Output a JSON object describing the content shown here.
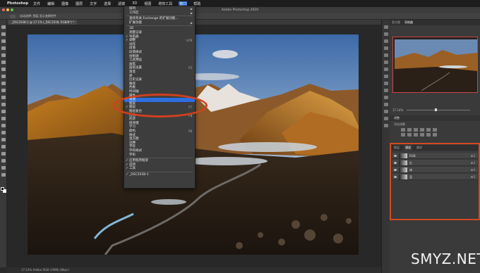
{
  "menubar": {
    "app": "Photoshop",
    "items": [
      "文件",
      "编辑",
      "图像",
      "图层",
      "文字",
      "选择",
      "滤镜",
      "3D",
      "视图",
      "增效工具",
      "窗口",
      "帮助"
    ],
    "active_index": 10
  },
  "window": {
    "title": "Adobe Photoshop 2020"
  },
  "document": {
    "tab": "_DSC2038-1 @ 17.1% (_DSC2038, RGB/8*) *"
  },
  "statusbar": {
    "text": "17.14%    Adobe RGB (1998) (8bpc)"
  },
  "window_menu": {
    "items": [
      {
        "label": "排列",
        "arrow": true
      },
      {
        "label": "工作区",
        "arrow": true
      },
      {
        "sep": true
      },
      {
        "label": "查找有关 Exchange 的扩展功能..."
      },
      {
        "label": "扩展功能",
        "arrow": true
      },
      {
        "sep": true
      },
      {
        "label": "3D"
      },
      {
        "label": "测量记录"
      },
      {
        "label": "导航器",
        "check": true
      },
      {
        "label": "调整",
        "check": true,
        "shortcut": "⌥F9"
      },
      {
        "label": "动作"
      },
      {
        "label": "段落"
      },
      {
        "label": "段落样式"
      },
      {
        "label": "仿制源"
      },
      {
        "label": "工具预设"
      },
      {
        "label": "画笔"
      },
      {
        "label": "画笔设置",
        "shortcut": "F5"
      },
      {
        "label": "渐变"
      },
      {
        "label": "库"
      },
      {
        "label": "历史记录"
      },
      {
        "label": "路径"
      },
      {
        "label": "色板"
      },
      {
        "label": "时间轴"
      },
      {
        "label": "属性"
      },
      {
        "label": "通道",
        "check": true,
        "highlight": true
      },
      {
        "label": "图案"
      },
      {
        "label": "图层",
        "check": true,
        "shortcut": "F7"
      },
      {
        "label": "图层复合"
      },
      {
        "label": "信息",
        "shortcut": "F8"
      },
      {
        "label": "形状"
      },
      {
        "label": "修改键"
      },
      {
        "label": "学习"
      },
      {
        "label": "颜色",
        "shortcut": "F6"
      },
      {
        "label": "样式"
      },
      {
        "label": "直方图"
      },
      {
        "label": "注释"
      },
      {
        "label": "字符"
      },
      {
        "label": "字符样式"
      },
      {
        "label": "字形"
      },
      {
        "sep": true
      },
      {
        "label": "应用程序框架",
        "check": true
      },
      {
        "label": "选项",
        "check": true
      },
      {
        "label": "工具",
        "check": true
      },
      {
        "sep": true
      },
      {
        "label": "_DSC2038-1",
        "check": true
      }
    ]
  },
  "right_panels": {
    "nav_tabs": [
      "直方图",
      "导航器"
    ],
    "nav_active": 1,
    "zoom": "17.14%",
    "adjust_tabs": [
      "调整"
    ],
    "adjust_sub": "添加调整",
    "layer_tabs": [
      "图层",
      "通道",
      "路径"
    ],
    "layer_active": 1,
    "channels": [
      {
        "name": "RGB",
        "key": "⌘2"
      },
      {
        "name": "红",
        "key": "⌘3"
      },
      {
        "name": "绿",
        "key": "⌘4"
      },
      {
        "name": "蓝",
        "key": "⌘5"
      }
    ]
  },
  "optbar": {
    "text": "自动选择:  图层   显示变换控件"
  },
  "watermark": "SMYZ.NET",
  "colors": {
    "highlight": "#2d6ee0",
    "annotation": "#d0401e"
  }
}
